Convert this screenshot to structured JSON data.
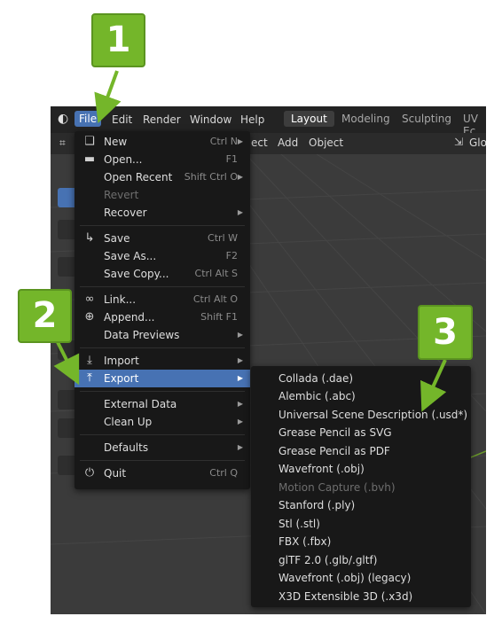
{
  "topbar": {
    "menus": [
      "File",
      "Edit",
      "Render",
      "Window",
      "Help"
    ],
    "workspace_tabs": [
      "Layout",
      "Modeling",
      "Sculpting",
      "UV Ec"
    ],
    "active_tab": "Layout"
  },
  "header2": {
    "items": [
      "ect",
      "Add",
      "Object"
    ],
    "transform_label": "Glo"
  },
  "file_menu": {
    "items": [
      {
        "label": "New",
        "shortcut": "Ctrl N",
        "icon": "new-file-icon",
        "arrow": true
      },
      {
        "label": "Open...",
        "shortcut": "F1",
        "icon": "folder-icon"
      },
      {
        "label": "Open Recent",
        "shortcut": "Shift Ctrl O",
        "arrow": true
      },
      {
        "label": "Revert",
        "disabled": true
      },
      {
        "label": "Recover",
        "arrow": true
      },
      {
        "label": "Save",
        "shortcut": "Ctrl W",
        "icon": "save-icon"
      },
      {
        "label": "Save As...",
        "shortcut": "F2"
      },
      {
        "label": "Save Copy...",
        "shortcut": "Ctrl Alt S"
      },
      {
        "label": "Link...",
        "shortcut": "Ctrl Alt O",
        "icon": "link-icon"
      },
      {
        "label": "Append...",
        "shortcut": "Shift F1",
        "icon": "append-icon"
      },
      {
        "label": "Data Previews",
        "arrow": true
      },
      {
        "label": "Import",
        "icon": "import-icon",
        "arrow": true
      },
      {
        "label": "Export",
        "icon": "export-icon",
        "arrow": true,
        "highlighted": true
      },
      {
        "label": "External Data",
        "arrow": true
      },
      {
        "label": "Clean Up",
        "arrow": true
      },
      {
        "label": "Defaults",
        "arrow": true
      },
      {
        "label": "Quit",
        "shortcut": "Ctrl Q",
        "icon": "power-icon"
      }
    ]
  },
  "export_menu": {
    "items": [
      {
        "label": "Collada (.dae)"
      },
      {
        "label": "Alembic (.abc)"
      },
      {
        "label": "Universal Scene Description (.usd*)"
      },
      {
        "label": "Grease Pencil as SVG"
      },
      {
        "label": "Grease Pencil as PDF"
      },
      {
        "label": "Wavefront (.obj)"
      },
      {
        "label": "Motion Capture (.bvh)",
        "disabled": true
      },
      {
        "label": "Stanford (.ply)"
      },
      {
        "label": "Stl (.stl)"
      },
      {
        "label": "FBX (.fbx)"
      },
      {
        "label": "glTF 2.0 (.glb/.gltf)"
      },
      {
        "label": "Wavefront (.obj) (legacy)"
      },
      {
        "label": "X3D Extensible 3D (.x3d)"
      }
    ]
  },
  "callouts": [
    "1",
    "2",
    "3"
  ],
  "colors": {
    "accent": "#4772b3",
    "callout": "#74b62a",
    "menu_bg": "#181818"
  }
}
